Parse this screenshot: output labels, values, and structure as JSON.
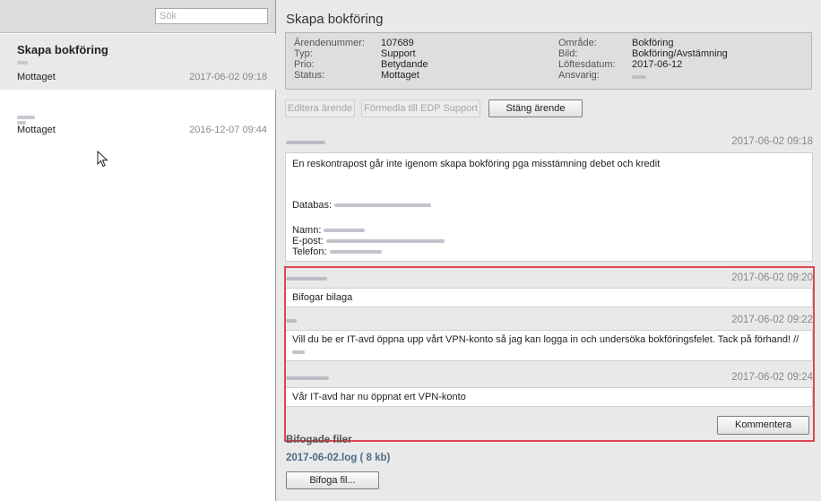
{
  "sidebar": {
    "search_placeholder": "Sök",
    "cases": [
      {
        "title": "Skapa bokföring",
        "status": "Mottaget",
        "date": "2017-06-02 09:18"
      },
      {
        "title": "",
        "status": "Mottaget",
        "date": "2016-12-07 09:44"
      }
    ]
  },
  "case": {
    "title": "Skapa bokföring",
    "info": {
      "arendenummer_label": "Ärendenummer:",
      "arendenummer": "107689",
      "typ_label": "Typ:",
      "typ": "Support",
      "prio_label": "Prio:",
      "prio": "Betydande",
      "status_label": "Status:",
      "status": "Mottaget",
      "omrade_label": "Område:",
      "omrade": "Bokföring",
      "bild_label": "Bild:",
      "bild": "Bokföring/Avstämning",
      "loftesdatum_label": "Löftesdatum:",
      "loftesdatum": "2017-06-12",
      "ansvarig_label": "Ansvarig:"
    },
    "buttons": {
      "edit": "Editera ärende",
      "forward": "Förmedla till EDP Support",
      "close": "Stäng ärende"
    },
    "messages": [
      {
        "date": "2017-06-02 09:18",
        "text": "En reskontrapost går inte igenom skapa bokföring pga misstämning debet och kredit",
        "databas_label": "Databas:",
        "namn_label": "Namn:",
        "epost_label": "E-post:",
        "telefon_label": "Telefon:"
      },
      {
        "date": "2017-06-02 09:20",
        "text": "Bifogar bilaga"
      },
      {
        "date": "2017-06-02 09:22",
        "text": "Vill du be er IT-avd öppna upp vårt VPN-konto så jag kan logga in och undersöka bokföringsfelet. Tack på förhand! //"
      },
      {
        "date": "2017-06-02 09:24",
        "text": "Vår IT-avd har nu öppnat ert VPN-konto"
      }
    ],
    "comment_button": "Kommentera",
    "attachments_label": "Bifogade filer",
    "attachment": "2017-06-02.log ( 8 kb)",
    "attach_button": "Bifoga fil..."
  },
  "colors": {
    "highlight": "#e0464f",
    "link": "#4e6b8a"
  }
}
